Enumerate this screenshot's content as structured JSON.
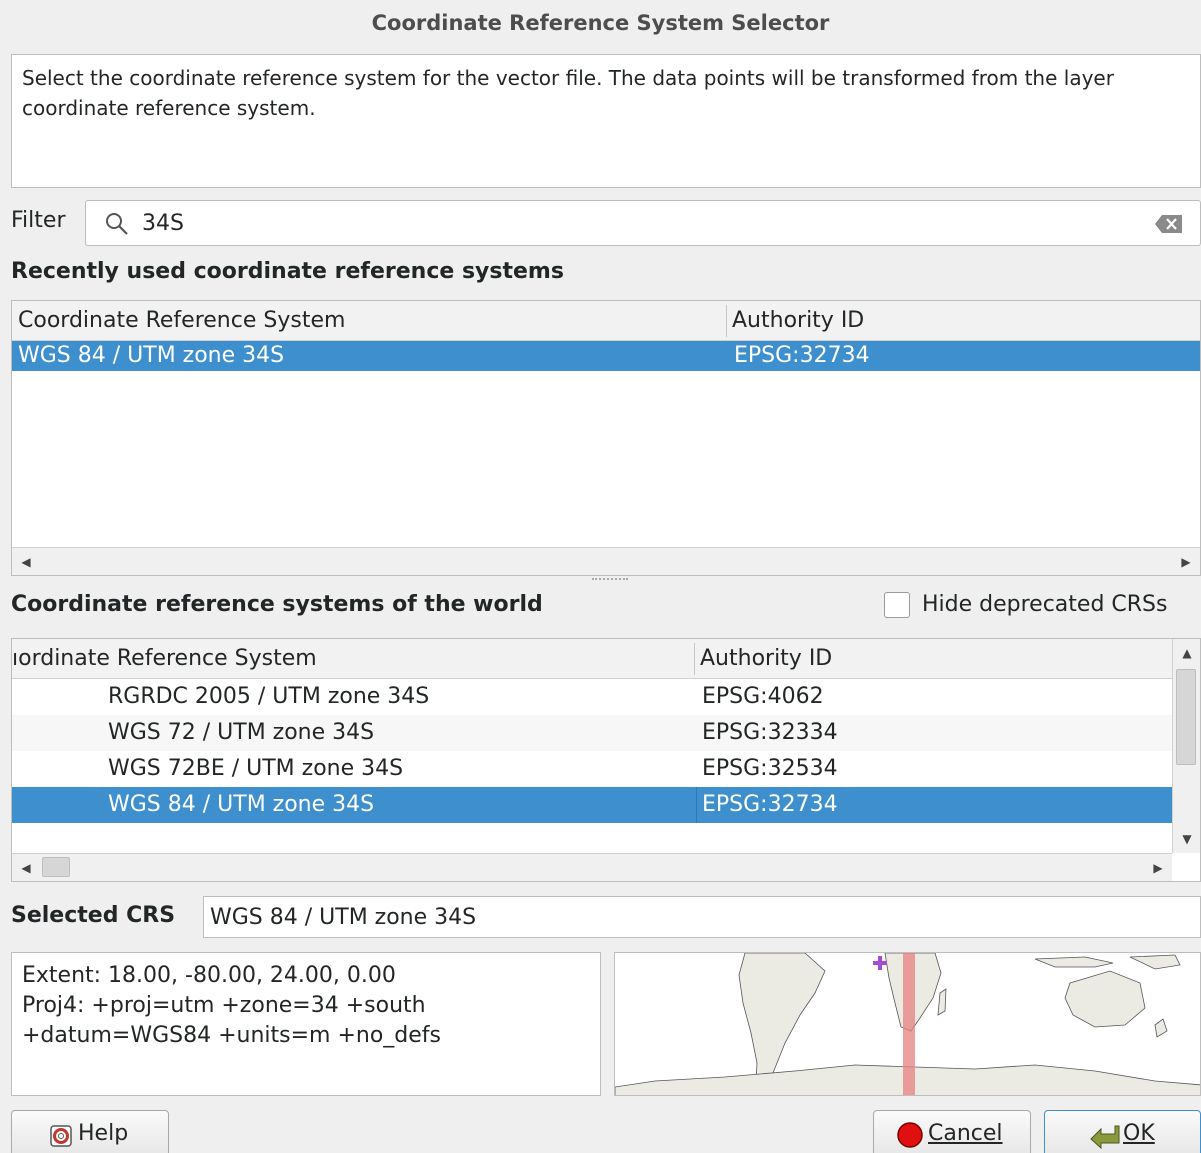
{
  "window": {
    "title": "Coordinate Reference System Selector"
  },
  "description": "Select the coordinate reference system for the vector file. The data points will be transformed from the layer coordinate reference system.",
  "filter": {
    "label": "Filter",
    "value": "34S"
  },
  "recent": {
    "title": "Recently used coordinate reference systems",
    "columns": [
      "Coordinate Reference System",
      "Authority ID"
    ],
    "rows": [
      {
        "name": "WGS 84 / UTM zone 34S",
        "id": "EPSG:32734",
        "selected": true
      }
    ]
  },
  "world": {
    "title": "Coordinate reference systems of the world",
    "hide_deprecated_label": "Hide deprecated CRSs",
    "hide_deprecated_checked": false,
    "columns": [
      "ıordinate Reference System",
      "Authority ID"
    ],
    "rows": [
      {
        "name": "RGRDC 2005 / UTM zone 34S",
        "id": "EPSG:4062",
        "selected": false
      },
      {
        "name": "WGS 72 / UTM zone 34S",
        "id": "EPSG:32334",
        "selected": false
      },
      {
        "name": "WGS 72BE / UTM zone 34S",
        "id": "EPSG:32534",
        "selected": false
      },
      {
        "name": "WGS 84 / UTM zone 34S",
        "id": "EPSG:32734",
        "selected": true
      }
    ]
  },
  "selected_crs": {
    "label": "Selected CRS",
    "value": "WGS 84 / UTM zone 34S"
  },
  "info": {
    "extent": "Extent: 18.00, -80.00, 24.00, 0.00",
    "proj_line1": "Proj4: +proj=utm +zone=34 +south",
    "proj_line2": "+datum=WGS84 +units=m +no_defs"
  },
  "buttons": {
    "help": "Help",
    "cancel": "Cancel",
    "ok": "OK"
  },
  "colors": {
    "selection": "#3d8fce",
    "extent_band": "#e88080",
    "crosshair": "#a64bd6"
  }
}
